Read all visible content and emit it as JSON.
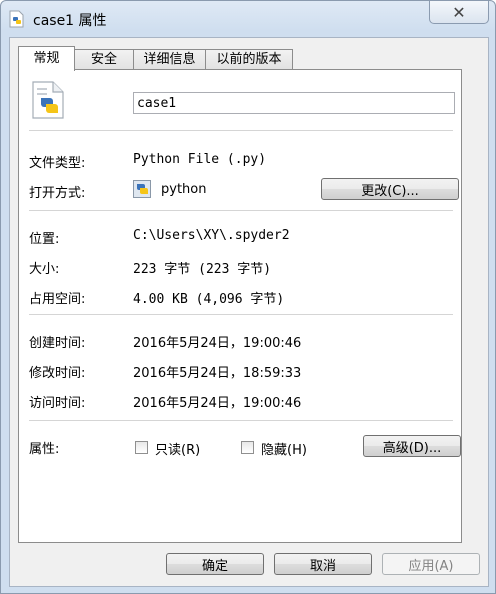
{
  "window": {
    "title": "case1 属性",
    "close_glyph": "✕"
  },
  "tabs": [
    {
      "label": "常规",
      "active": true
    },
    {
      "label": "安全"
    },
    {
      "label": "详细信息"
    },
    {
      "label": "以前的版本"
    }
  ],
  "general": {
    "file_name": "case1",
    "file_type_label": "文件类型:",
    "file_type_value": "Python File (.py)",
    "opens_with_label": "打开方式:",
    "opens_with_value": "python",
    "change_button": "更改(C)...",
    "location_label": "位置:",
    "location_value": "C:\\Users\\XY\\.spyder2",
    "size_label": "大小:",
    "size_value": "223 字节 (223 字节)",
    "size_on_disk_label": "占用空间:",
    "size_on_disk_value": "4.00 KB (4,096 字节)",
    "created_label": "创建时间:",
    "created_value": "2016年5月24日，19:00:46",
    "modified_label": "修改时间:",
    "modified_value": "2016年5月24日，18:59:33",
    "accessed_label": "访问时间:",
    "accessed_value": "2016年5月24日，19:00:46",
    "attributes_label": "属性:",
    "readonly_label": "只读(R)",
    "hidden_label": "隐藏(H)",
    "advanced_button": "高级(D)..."
  },
  "footer": {
    "ok": "确定",
    "cancel": "取消",
    "apply": "应用(A)"
  },
  "icons": [
    "python-file-icon",
    "python-app-icon",
    "close-icon"
  ]
}
